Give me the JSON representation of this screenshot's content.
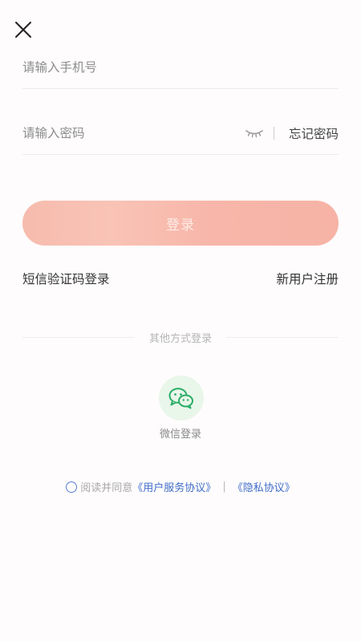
{
  "phone_field": {
    "placeholder": "请输入手机号",
    "value": ""
  },
  "password_field": {
    "placeholder": "请输入密码",
    "value": "",
    "forgot_label": "忘记密码"
  },
  "login_button": {
    "label": "登录"
  },
  "links": {
    "sms_login": "短信验证码登录",
    "register": "新用户注册"
  },
  "other_methods": {
    "label": "其他方式登录",
    "wechat_label": "微信登录"
  },
  "agreement": {
    "prefix": "阅读并同意",
    "service_link": "《用户服务协议》",
    "separator": "|",
    "privacy_link": "《隐私协议》"
  },
  "colors": {
    "accent_blue": "#3f6cc9",
    "login_button": "#f7b9ac",
    "wechat_green": "#2aae67"
  },
  "icons": {
    "close": "close-icon",
    "password_visibility": "eye-closed-icon",
    "wechat": "wechat-icon"
  }
}
